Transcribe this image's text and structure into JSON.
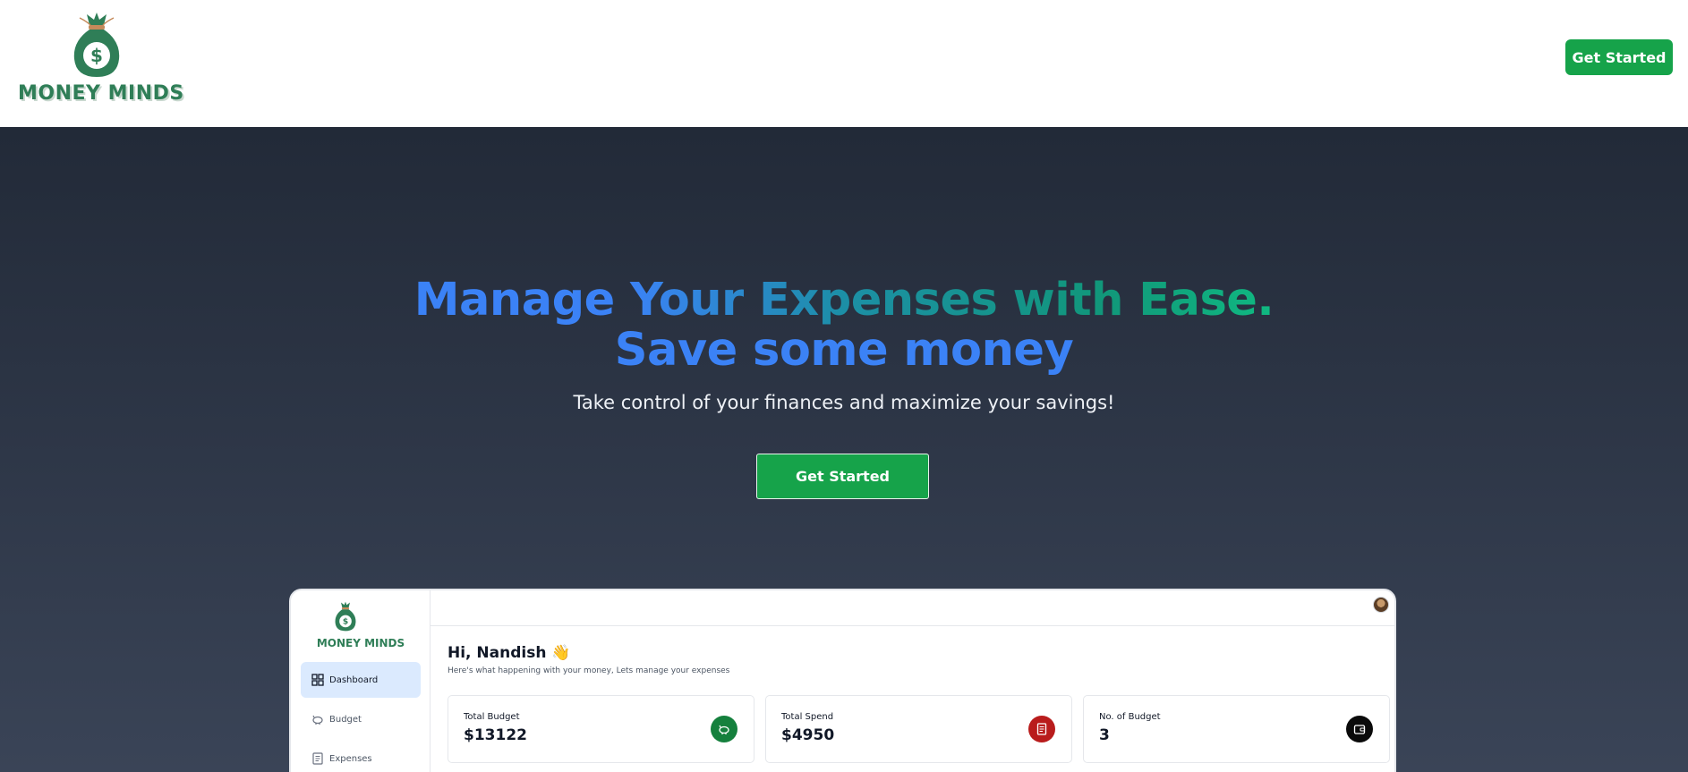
{
  "brand": {
    "name": "MONEY MINDS"
  },
  "navbar": {
    "cta_label": "Get Started"
  },
  "hero": {
    "headline_line1": "Manage Your Expenses with Ease.",
    "headline_line2": "Save some money",
    "subtitle": "Take control of your finances and maximize your savings!",
    "cta_label": "Get Started"
  },
  "preview": {
    "brand_name": "MONEY MINDS",
    "menu": [
      {
        "label": "Dashboard",
        "icon": "grid-icon",
        "active": true
      },
      {
        "label": "Budget",
        "icon": "piggy-bank-icon",
        "active": false
      },
      {
        "label": "Expenses",
        "icon": "receipt-icon",
        "active": false
      }
    ],
    "greeting": "Hi, Nandish 👋",
    "greeting_sub": "Here's what happening with your money, Lets manage your expenses",
    "cards": [
      {
        "label": "Total Budget",
        "value": "$13122",
        "icon": "piggy-bank-icon",
        "color": "#15803d"
      },
      {
        "label": "Total Spend",
        "value": "$4950",
        "icon": "receipt-icon",
        "color": "#b91c1c"
      },
      {
        "label": "No. of Budget",
        "value": "3",
        "icon": "wallet-icon",
        "color": "#0a0a0a"
      }
    ]
  },
  "colors": {
    "brand_green": "#16a34a",
    "logo_green": "#2f7e57",
    "headline_blue": "#3b82f6",
    "headline_teal": "#10b981",
    "hero_bg": "#2a3242",
    "active_menu_bg": "#dbeafe"
  }
}
